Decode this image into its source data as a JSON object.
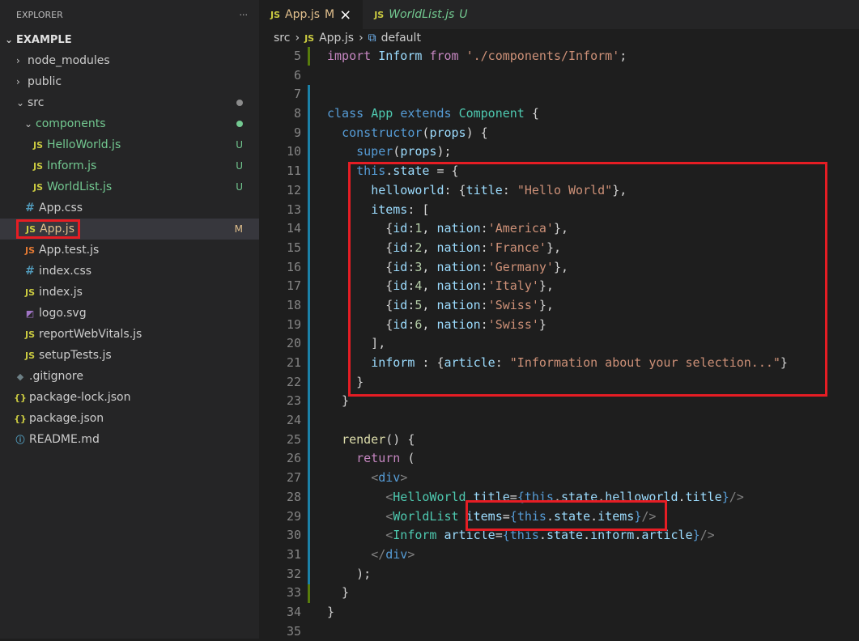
{
  "explorer": {
    "title": "EXPLORER",
    "more": "···",
    "folder": "EXAMPLE",
    "items": [
      {
        "label": "node_modules"
      },
      {
        "label": "public"
      },
      {
        "label": "src"
      },
      {
        "label": "components"
      },
      {
        "label": "HelloWorld.js",
        "icon": "JS",
        "status": "U"
      },
      {
        "label": "Inform.js",
        "icon": "JS",
        "status": "U"
      },
      {
        "label": "WorldList.js",
        "icon": "JS",
        "status": "U"
      },
      {
        "label": "App.css",
        "icon": "#"
      },
      {
        "label": "App.js",
        "icon": "JS",
        "status": "M"
      },
      {
        "label": "App.test.js",
        "icon": "JS"
      },
      {
        "label": "index.css",
        "icon": "#"
      },
      {
        "label": "index.js",
        "icon": "JS"
      },
      {
        "label": "logo.svg"
      },
      {
        "label": "reportWebVitals.js",
        "icon": "JS"
      },
      {
        "label": "setupTests.js",
        "icon": "JS"
      },
      {
        "label": ".gitignore"
      },
      {
        "label": "package-lock.json",
        "icon": "{}"
      },
      {
        "label": "package.json",
        "icon": "{}"
      },
      {
        "label": "README.md"
      }
    ]
  },
  "tabs": [
    {
      "icon": "JS",
      "label": "App.js",
      "status": "M",
      "close": "×"
    },
    {
      "icon": "JS",
      "label": "WorldList.js",
      "status": "U"
    }
  ],
  "breadcrumb": {
    "root": "src",
    "file_icon": "JS",
    "file": "App.js",
    "symbol": "default"
  },
  "code": {
    "line_numbers": [
      "5",
      "6",
      "7",
      "8",
      "9",
      "10",
      "11",
      "12",
      "13",
      "14",
      "15",
      "16",
      "17",
      "18",
      "19",
      "20",
      "21",
      "22",
      "23",
      "24",
      "25",
      "26",
      "27",
      "28",
      "29",
      "30",
      "31",
      "32",
      "33",
      "34",
      "35"
    ]
  },
  "colors": {
    "accent_red": "#e61d24",
    "modified": "#e2c08d",
    "untracked": "#73c991"
  }
}
